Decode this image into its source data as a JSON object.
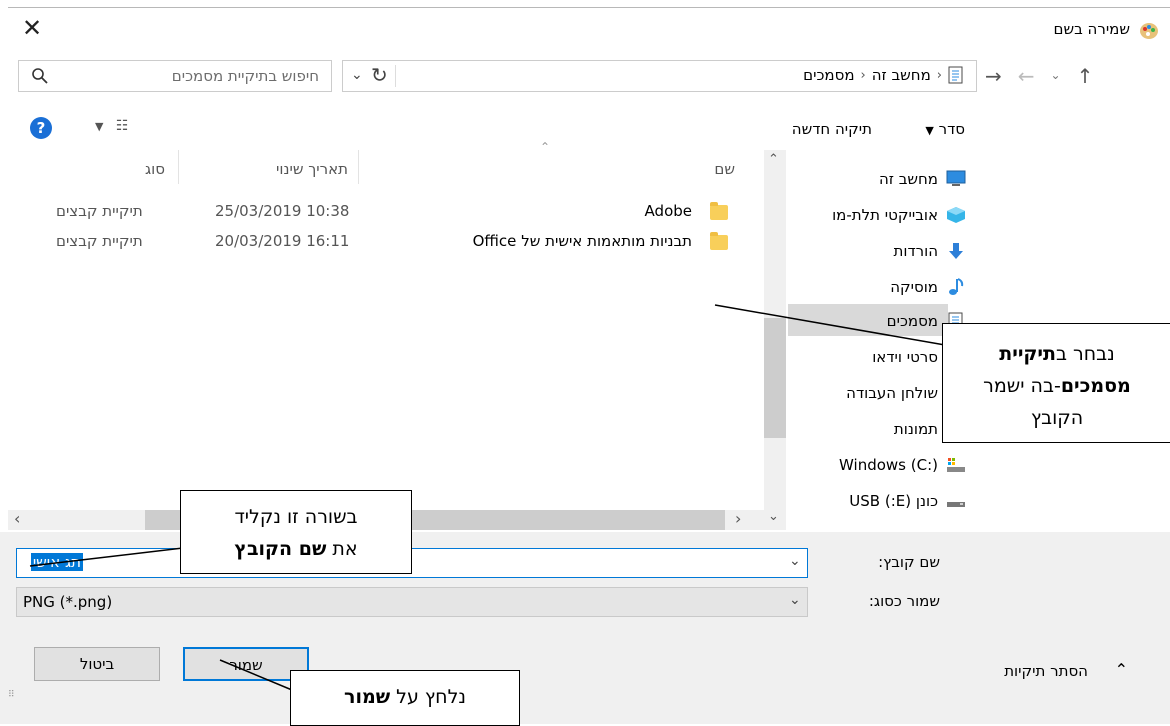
{
  "window": {
    "title": "שמירה בשם"
  },
  "search": {
    "placeholder": "חיפוש בתיקיית מסמכים"
  },
  "breadcrumb": {
    "items": [
      "מחשב זה",
      "מסמכים"
    ]
  },
  "toolbar": {
    "sort_label": "סדר",
    "new_folder_label": "תיקיה חדשה"
  },
  "columns": {
    "name": "שם",
    "date": "תאריך שינוי",
    "type": "סוג"
  },
  "files": [
    {
      "name": "Adobe",
      "date": "25/03/2019 10:38",
      "type": "תיקיית קבצים"
    },
    {
      "name": "תבניות מותאמות אישית של Office",
      "date": "20/03/2019 16:11",
      "type": "תיקיית קבצים"
    }
  ],
  "nav": {
    "items": [
      {
        "label": "מחשב זה",
        "icon": "monitor-icon"
      },
      {
        "label": "אובייקטי תלת-מו",
        "icon": "3d-objects-icon"
      },
      {
        "label": "הורדות",
        "icon": "download-arrow-icon"
      },
      {
        "label": "מוסיקה",
        "icon": "music-note-icon"
      },
      {
        "label": "מסמכים",
        "icon": "document-icon"
      },
      {
        "label": "סרטי וידאו",
        "icon": "video-icon"
      },
      {
        "label": "שולחן העבודה",
        "icon": "desktop-icon"
      },
      {
        "label": "תמונות",
        "icon": "pictures-icon"
      },
      {
        "label": "Windows (C:)",
        "icon": "drive-c-icon"
      },
      {
        "label": "כונן (E:) USB",
        "icon": "usb-drive-icon"
      }
    ]
  },
  "form": {
    "filename_label": "שם קובץ:",
    "filename_value": "תג אישי",
    "filetype_label": "שמור כסוג:",
    "filetype_value": "PNG (*.png)"
  },
  "buttons": {
    "save": "שמור",
    "cancel": "ביטול",
    "hide_folders": "הסתר תיקיות"
  },
  "callouts": {
    "folder_line1_plain": "נבחר ב",
    "folder_line1_bold": "תיקיית",
    "folder_line2_bold": "מסמכים",
    "folder_line2_plain": "-בה ישמר",
    "folder_line3": "הקובץ",
    "name_line1": "בשורה זו נקליד",
    "name_line2_plain": "את ",
    "name_line2_bold": "שם הקובץ",
    "save_plain": "נלחץ על ",
    "save_bold": "שמור"
  },
  "colors": {
    "accent": "#0078d7",
    "selection_bg": "#d9d9d9",
    "folder_yellow": "#f8cf5a"
  }
}
